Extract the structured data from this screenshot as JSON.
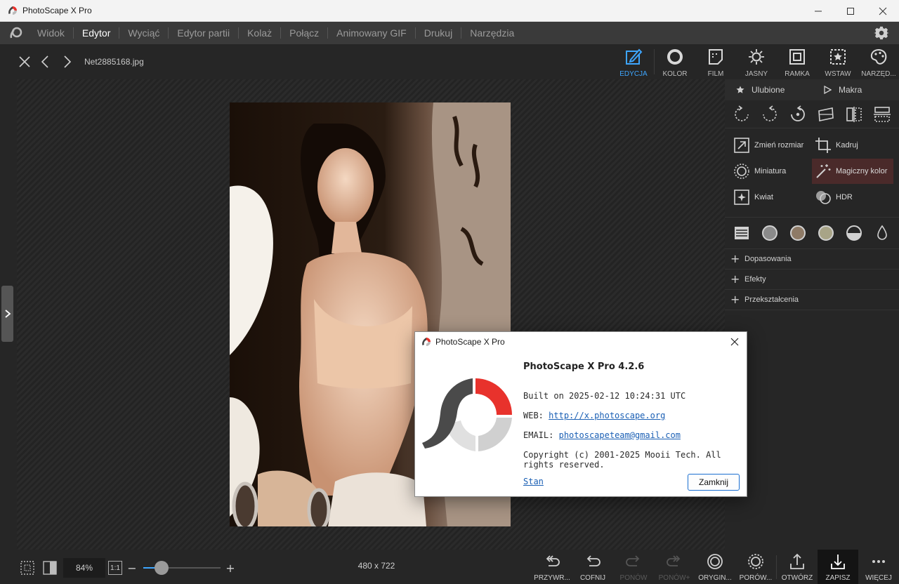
{
  "window": {
    "title": "PhotoScape X Pro"
  },
  "menu": {
    "items": [
      {
        "label": "Widok",
        "active": false
      },
      {
        "label": "Edytor",
        "active": true
      },
      {
        "label": "Wyciąć",
        "active": false
      },
      {
        "label": "Edytor partii",
        "active": false
      },
      {
        "label": "Kolaż",
        "active": false
      },
      {
        "label": "Połącz",
        "active": false
      },
      {
        "label": "Animowany GIF",
        "active": false
      },
      {
        "label": "Drukuj",
        "active": false
      },
      {
        "label": "Narzędzia",
        "active": false
      }
    ]
  },
  "toolbar": {
    "filename": "Net2885168.jpg",
    "modes": [
      {
        "label": "EDYCJA",
        "icon": "edit-icon",
        "active": true
      },
      {
        "label": "KOLOR",
        "icon": "color-icon"
      },
      {
        "label": "FILM",
        "icon": "film-icon"
      },
      {
        "label": "JASNY",
        "icon": "light-icon"
      },
      {
        "label": "RAMKA",
        "icon": "frame-icon"
      },
      {
        "label": "WSTAW",
        "icon": "insert-icon"
      },
      {
        "label": "NARZĘD...",
        "icon": "tools-icon"
      }
    ]
  },
  "panel": {
    "favorites": "Ulubione",
    "macros": "Makra",
    "tools": [
      {
        "label": "Zmień rozmiar",
        "icon": "resize-icon"
      },
      {
        "label": "Kadruj",
        "icon": "crop-icon"
      },
      {
        "label": "Miniatura",
        "icon": "miniature-icon"
      },
      {
        "label": "Magiczny kolor",
        "icon": "magic-wand-icon",
        "highlight": true
      },
      {
        "label": "Kwiat",
        "icon": "bloom-icon"
      },
      {
        "label": "HDR",
        "icon": "hdr-icon"
      }
    ],
    "sections": [
      "Dopasowania",
      "Efekty",
      "Przekształcenia"
    ]
  },
  "bottom": {
    "zoom": "84%",
    "one_to_one": "1:1",
    "zoom_level": 0.18,
    "dimensions": "480 x 722",
    "actions": [
      {
        "label": "PRZYWR...",
        "icon": "revert-icon",
        "disabled": false
      },
      {
        "label": "COFNIJ",
        "icon": "undo-icon",
        "disabled": false
      },
      {
        "label": "PONÓW",
        "icon": "redo-icon",
        "disabled": true
      },
      {
        "label": "PONÓW+",
        "icon": "redo-all-icon",
        "disabled": true
      },
      {
        "label": "ORYGIN...",
        "icon": "original-icon",
        "disabled": false
      },
      {
        "label": "PORÓW...",
        "icon": "compare-icon",
        "disabled": false
      },
      {
        "label": "OTWÓRZ",
        "icon": "share-icon",
        "disabled": false
      },
      {
        "label": "ZAPISZ",
        "icon": "save-icon",
        "disabled": false
      },
      {
        "label": "WIĘCEJ",
        "icon": "more-icon",
        "disabled": false
      }
    ]
  },
  "dialog": {
    "title": "PhotoScape X Pro",
    "heading": "PhotoScape X Pro 4.2.6",
    "built": "Built on 2025-02-12 10:24:31 UTC",
    "web_label": "WEB:",
    "web_url": "http://x.photoscape.org",
    "email_label": "EMAIL:",
    "email": "photoscapeteam@gmail.com",
    "copyright": "Copyright (c) 2001-2025 Mooii Tech. All rights reserved.",
    "status_link": "Stan",
    "close_button": "Zamknij"
  },
  "colors": {
    "accent": "#3ea6ff",
    "logo_red": "#e8322c",
    "logo_dark": "#4a4a4a"
  }
}
